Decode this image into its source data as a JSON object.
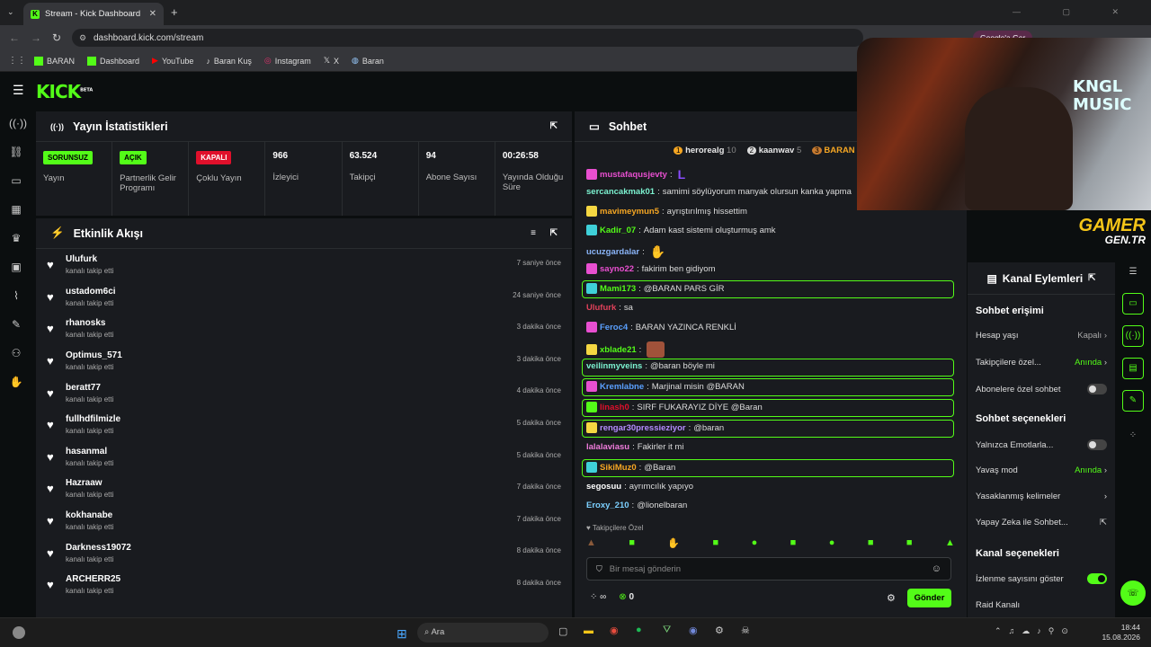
{
  "browser": {
    "tab_title": "Stream - Kick Dashboard",
    "url": "dashboard.kick.com/stream",
    "profile_label": "Google'a Ger",
    "bookmarks": [
      "BARAN",
      "Dashboard",
      "YouTube",
      "Baran Kuş",
      "Instagram",
      "X",
      "Baran"
    ]
  },
  "app": {
    "logo": "KICK",
    "beta": "BETA"
  },
  "stats": {
    "title": "Yayın İstatistikleri",
    "items": [
      {
        "badge": "SORUNSUZ",
        "badge_color": "#53fc18",
        "label": "Yayın"
      },
      {
        "badge": "AÇIK",
        "badge_color": "#53fc18",
        "label": "Partnerlik Gelir Programı"
      },
      {
        "badge": "KAPALI",
        "badge_color": "#e0102b",
        "label": "Çoklu Yayın"
      },
      {
        "value": "966",
        "label": "İzleyici"
      },
      {
        "value": "63.524",
        "label": "Takipçi"
      },
      {
        "value": "94",
        "label": "Abone Sayısı"
      },
      {
        "value": "00:26:58",
        "label": "Yayında Olduğu Süre"
      }
    ]
  },
  "feed": {
    "title": "Etkinlik Akışı",
    "items": [
      {
        "name": "Ulufurk",
        "sub": "kanalı takip etti",
        "time": "7 saniye önce"
      },
      {
        "name": "ustadom6ci",
        "sub": "kanalı takip etti",
        "time": "24 saniye önce"
      },
      {
        "name": "rhanosks",
        "sub": "kanalı takip etti",
        "time": "3 dakika önce"
      },
      {
        "name": "Optimus_571",
        "sub": "kanalı takip etti",
        "time": "3 dakika önce"
      },
      {
        "name": "beratt77",
        "sub": "kanalı takip etti",
        "time": "4 dakika önce"
      },
      {
        "name": "fullhdfilmizle",
        "sub": "kanalı takip etti",
        "time": "5 dakika önce"
      },
      {
        "name": "hasanmal",
        "sub": "kanalı takip etti",
        "time": "5 dakika önce"
      },
      {
        "name": "Hazraaw",
        "sub": "kanalı takip etti",
        "time": "7 dakika önce"
      },
      {
        "name": "kokhanabe",
        "sub": "kanalı takip etti",
        "time": "7 dakika önce"
      },
      {
        "name": "Darkness19072",
        "sub": "kanalı takip etti",
        "time": "8 dakika önce"
      },
      {
        "name": "ARCHERR25",
        "sub": "kanalı takip etti",
        "time": "8 dakika önce"
      }
    ]
  },
  "chat": {
    "title": "Sohbet",
    "leaders": [
      {
        "rank": "1",
        "name": "herorealg",
        "count": "10"
      },
      {
        "rank": "2",
        "name": "kaanwav",
        "count": "5"
      },
      {
        "rank": "3",
        "name": "BARAN"
      }
    ],
    "messages": [
      {
        "user": "mustafaqusjevty",
        "color": "#e84fd0",
        "text": "",
        "badge": "#e84fd0"
      },
      {
        "user": "sercancakmak01",
        "color": "#7cf2d0",
        "text": "samimi söylüyorum manyak olursun kanka yapma"
      },
      {
        "user": "mavimeymun5",
        "color": "#f5a623",
        "text": "ayrıştırılmış hissettim",
        "badge": "#f5d742"
      },
      {
        "user": "Kadir_07",
        "color": "#53fc18",
        "text": "Adam kast sistemi oluşturmuş amk",
        "badge": "#3fd0d9"
      },
      {
        "user": "ucuzgardalar",
        "color": "#8ab4f8",
        "text": ""
      },
      {
        "user": "sayno22",
        "color": "#e84fd0",
        "text": "fakirim ben gidiyom",
        "badge": "#e84fd0"
      },
      {
        "user": "Mami173",
        "color": "#53fc18",
        "text": "@BARAN PARS GİR",
        "badge": "#3fd0d9"
      },
      {
        "user": "Ulufurk",
        "color": "#e0415a",
        "text": "sa"
      },
      {
        "user": "Feroc4",
        "color": "#5aa0ff",
        "text": "BARAN YAZINCA RENKLİ",
        "badge": "#e84fd0"
      },
      {
        "user": "xblade21",
        "color": "#53fc18",
        "text": "",
        "badge": "#f5d742"
      },
      {
        "user": "veilinmyveins",
        "color": "#7cf2d0",
        "text": "@baran böyle mi"
      },
      {
        "user": "Kremlabne",
        "color": "#5aa0ff",
        "text": "Marjinal misin @BARAN",
        "badge": "#e84fd0"
      },
      {
        "user": "linash0",
        "color": "#e0102b",
        "text": "SIRF FUKARAYIZ DİYE @Baran",
        "badge": "#53fc18"
      },
      {
        "user": "rengar30pressieziyor",
        "color": "#b58cff",
        "text": "@baran",
        "badge": "#f5d742"
      },
      {
        "user": "lalalaviasu",
        "color": "#f07cdc",
        "text": "Fakirler it mi"
      },
      {
        "user": "SikiMuz0",
        "color": "#f5a623",
        "text": "@Baran",
        "badge": "#3fd0d9"
      },
      {
        "user": "segosuu",
        "color": "#fff",
        "text": "ayrımcılık yapıyo"
      },
      {
        "user": "Eroxy_210",
        "color": "#7cd0ff",
        "text": "@lionelbaran"
      }
    ],
    "follower_label": "Takipçilere Özel",
    "input_placeholder": "Bir mesaj gönderin",
    "count": "0",
    "send": "Gönder"
  },
  "actions": {
    "title": "Kanal Eylemleri",
    "sec1": "Sohbet erişimi",
    "r1": "Hesap yaşı",
    "r1v": "Kapalı",
    "r2": "Takipçilere özel...",
    "r2v": "Anında",
    "r3": "Abonelere özel sohbet",
    "sec2": "Sohbet seçenekleri",
    "r4": "Yalnızca Emotlarla...",
    "r5": "Yavaş mod",
    "r5v": "Anında",
    "r6": "Yasaklanmış kelimeler",
    "r7": "Yapay Zeka ile Sohbet...",
    "sec3": "Kanal seçenekleri",
    "r8": "İzlenme sayısını göster",
    "r9": "Raid Kanalı"
  },
  "overlay": {
    "text1": "GAMER",
    "text2": "GEN.TR"
  },
  "taskbar": {
    "search": "Ara",
    "time": "18:44",
    "date": "15.08.2026"
  }
}
